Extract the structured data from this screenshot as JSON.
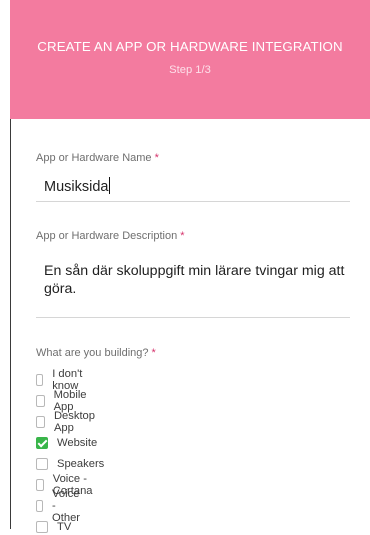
{
  "header": {
    "title": "CREATE AN APP OR HARDWARE INTEGRATION",
    "step": "Step 1/3",
    "color": "#f37b9f"
  },
  "form": {
    "name": {
      "label": "App or Hardware Name",
      "required_mark": "*",
      "value": "Musiksida"
    },
    "description": {
      "label": "App or Hardware Description",
      "required_mark": "*",
      "value": "En sån där skoluppgift min lärare tvingar mig att göra."
    },
    "building": {
      "label": "What are you building?",
      "required_mark": "*",
      "options": [
        {
          "label": "I don't know",
          "checked": false
        },
        {
          "label": "Mobile App",
          "checked": false
        },
        {
          "label": "Desktop App",
          "checked": false
        },
        {
          "label": "Website",
          "checked": true
        },
        {
          "label": "Speakers",
          "checked": false
        },
        {
          "label": "Voice - Cortana",
          "checked": false
        },
        {
          "label": "Voice - Other",
          "checked": false
        },
        {
          "label": "TV",
          "checked": false
        }
      ]
    }
  },
  "colors": {
    "checkbox_checked": "#39b54a",
    "required": "#d6336c"
  }
}
